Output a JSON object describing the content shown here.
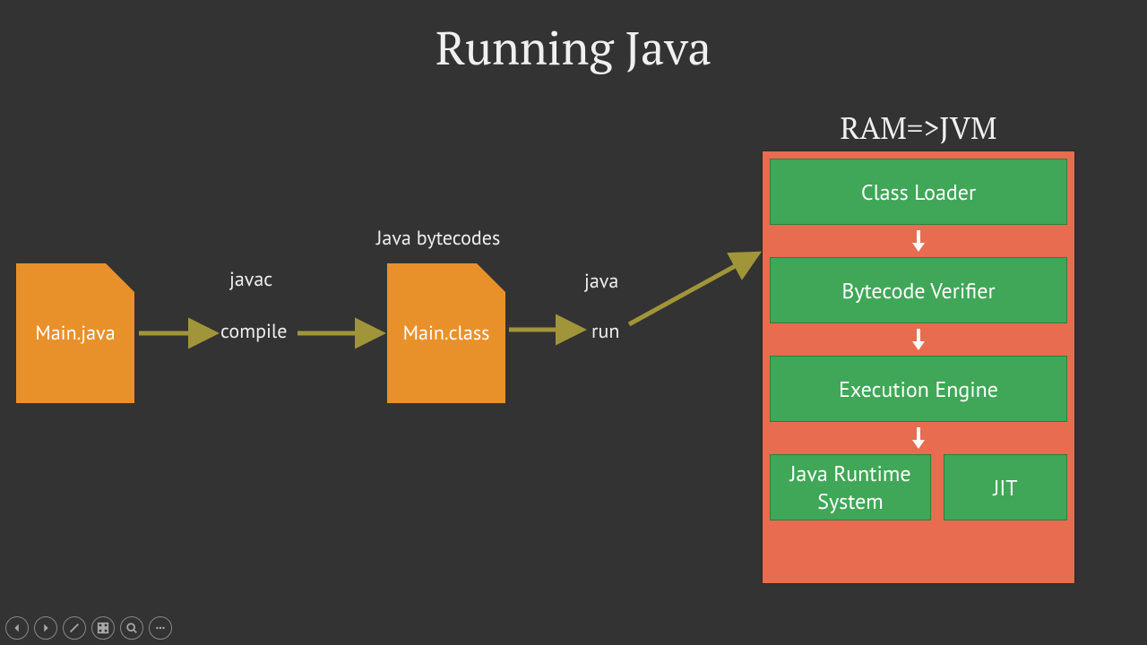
{
  "title": "Running Java",
  "source_file": "Main.java",
  "compiled_file": "Main.class",
  "labels": {
    "javac": "javac",
    "compile": "compile",
    "bytecodes": "Java bytecodes",
    "java_cmd": "java",
    "run": "run"
  },
  "jvm": {
    "header": "RAM=>JVM",
    "class_loader": "Class Loader",
    "bytecode_verifier": "Bytecode Verifier",
    "execution_engine": "Execution Engine",
    "runtime_system": "Java Runtime System",
    "jit": "JIT"
  },
  "colors": {
    "bg": "#333333",
    "file": "#E8912A",
    "jvm_container": "#E86C4F",
    "jvm_box": "#3FA757",
    "arrow": "#A1953A"
  }
}
